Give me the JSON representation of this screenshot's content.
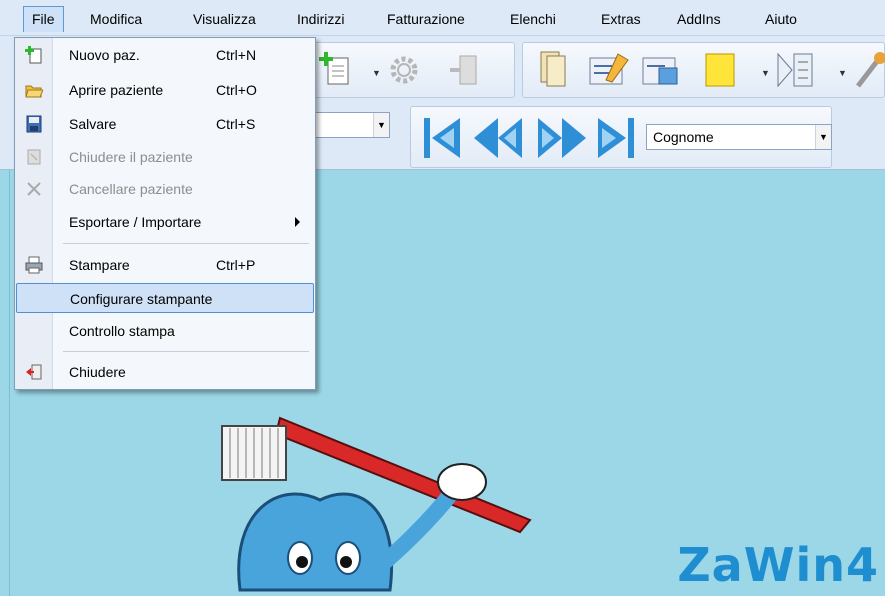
{
  "menubar": {
    "items": [
      "File",
      "Modifica",
      "Visualizza",
      "Indirizzi",
      "Fatturazione",
      "Elenchi",
      "Extras",
      "AddIns",
      "Aiuto"
    ]
  },
  "toolbar": {
    "sort_combo_value": "Cognome"
  },
  "file_menu": {
    "items": [
      {
        "label": "Nuovo paz.",
        "shortcut": "Ctrl+N",
        "icon": "new-patient-icon",
        "enabled": true
      },
      {
        "label": "Aprire paziente",
        "shortcut": "Ctrl+O",
        "icon": "open-folder-icon",
        "enabled": true
      },
      {
        "label": "Salvare",
        "shortcut": "Ctrl+S",
        "icon": "save-disk-icon",
        "enabled": true
      },
      {
        "label": "Chiudere il paziente",
        "shortcut": "",
        "icon": "close-patient-icon",
        "enabled": false
      },
      {
        "label": "Cancellare paziente",
        "shortcut": "",
        "icon": "delete-x-icon",
        "enabled": false
      },
      {
        "label": "Esportare / Importare",
        "shortcut": "",
        "icon": "",
        "enabled": true,
        "submenu": true
      },
      {
        "label": "Stampare",
        "shortcut": "Ctrl+P",
        "icon": "printer-icon",
        "enabled": true
      },
      {
        "label": "Configurare stampante",
        "shortcut": "",
        "icon": "",
        "enabled": true,
        "selected": true
      },
      {
        "label": "Controllo stampa",
        "shortcut": "",
        "icon": "",
        "enabled": true
      },
      {
        "label": "Chiudere",
        "shortcut": "",
        "icon": "exit-door-icon",
        "enabled": true
      }
    ]
  },
  "logo_text": "ZaWin4",
  "colors": {
    "workspace": "#9bd7e6",
    "menu_selection": "#cfe1f6",
    "logo": "#1e8ed0",
    "nav_arrows": "#2f8fd6"
  }
}
